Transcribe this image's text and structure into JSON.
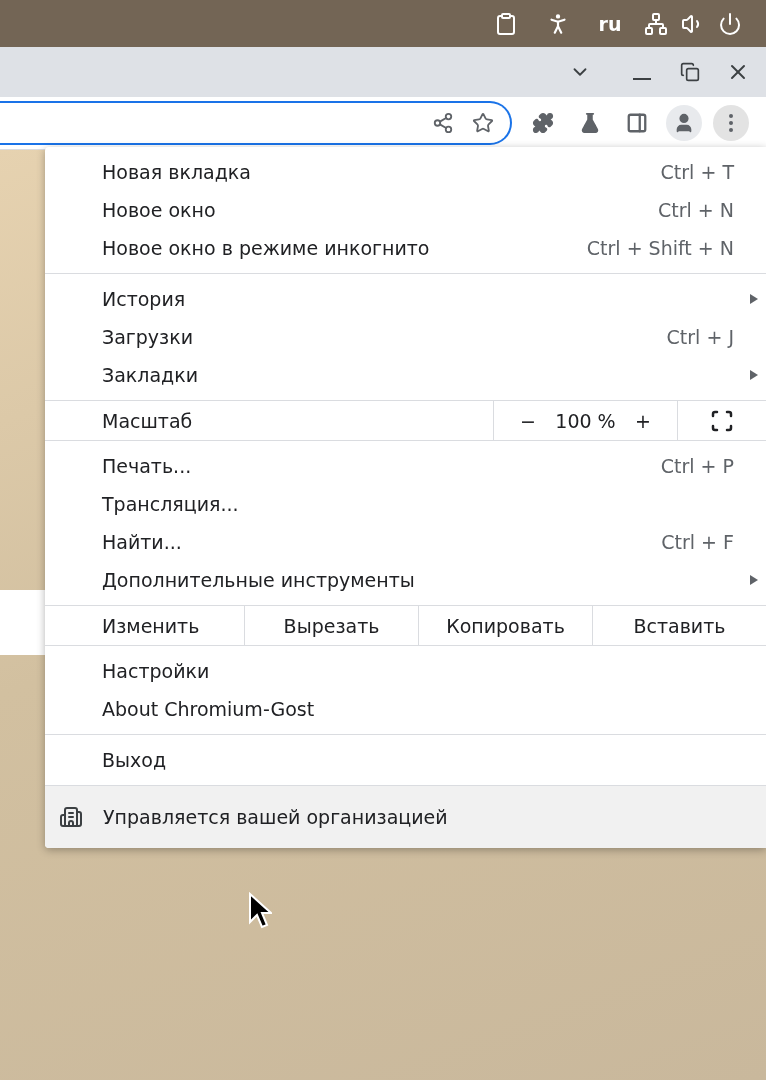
{
  "system_bar": {
    "language": "ru"
  },
  "menu": {
    "sections": [
      [
        {
          "kind": "item",
          "label": "Новая вкладка",
          "shortcut": "Ctrl + T",
          "submenu": false
        },
        {
          "kind": "item",
          "label": "Новое окно",
          "shortcut": "Ctrl + N",
          "submenu": false
        },
        {
          "kind": "item",
          "label": "Новое окно в режиме инкогнито",
          "shortcut": "Ctrl + Shift + N",
          "submenu": false
        }
      ],
      [
        {
          "kind": "item",
          "label": "История",
          "submenu": true
        },
        {
          "kind": "item",
          "label": "Загрузки",
          "shortcut": "Ctrl + J",
          "submenu": false
        },
        {
          "kind": "item",
          "label": "Закладки",
          "submenu": true
        }
      ],
      [
        {
          "kind": "zoom",
          "label": "Масштаб",
          "minus": "−",
          "value": "100 %",
          "plus": "+"
        }
      ],
      [
        {
          "kind": "item",
          "label": "Печать...",
          "shortcut": "Ctrl + P",
          "submenu": false
        },
        {
          "kind": "item",
          "label": "Трансляция...",
          "submenu": false
        },
        {
          "kind": "item",
          "label": "Найти...",
          "shortcut": "Ctrl + F",
          "submenu": false
        },
        {
          "kind": "item",
          "label": "Дополнительные инструменты",
          "submenu": true
        }
      ],
      [
        {
          "kind": "edit",
          "label": "Изменить",
          "actions": [
            "Вырезать",
            "Копировать",
            "Вставить"
          ]
        }
      ],
      [
        {
          "kind": "item",
          "label": "Настройки",
          "submenu": false
        },
        {
          "kind": "item",
          "label": "About Chromium-Gost",
          "submenu": false
        }
      ],
      [
        {
          "kind": "item",
          "label": "Выход",
          "submenu": false
        }
      ],
      [
        {
          "kind": "managed",
          "label": "Управляется вашей организацией"
        }
      ]
    ]
  }
}
